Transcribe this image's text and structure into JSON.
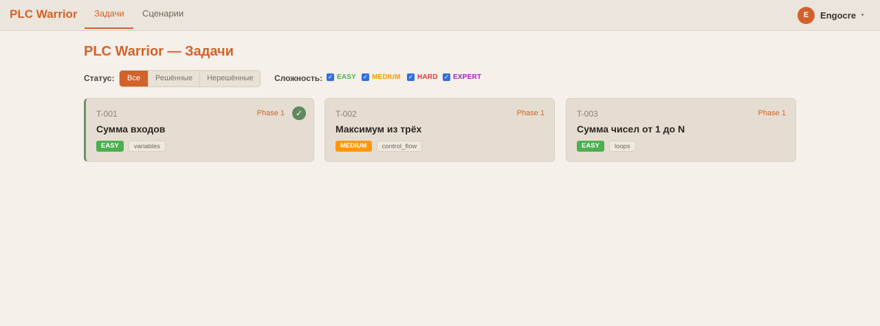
{
  "app": {
    "brand": "PLC Warrior"
  },
  "nav": {
    "tabs": [
      {
        "label": "Задачи",
        "active": true
      },
      {
        "label": "Сценарии",
        "active": false
      }
    ]
  },
  "user": {
    "initial": "E",
    "name": "Engocre"
  },
  "page": {
    "title": "PLC Warrior — Задачи"
  },
  "filters": {
    "status_label": "Статус:",
    "status_options": [
      "Все",
      "Решённые",
      "Нерешённые"
    ],
    "status_selected": "Все",
    "difficulty_label": "Сложность:",
    "difficulties": [
      {
        "label": "EASY",
        "checked": true,
        "color": "#4caf50"
      },
      {
        "label": "MEDIUM",
        "checked": true,
        "color": "#ff9800"
      },
      {
        "label": "HARD",
        "checked": true,
        "color": "#e53935"
      },
      {
        "label": "EXPERT",
        "checked": true,
        "color": "#9c27b0"
      }
    ]
  },
  "tasks": [
    {
      "id": "T-001",
      "phase": "Phase 1",
      "title": "Сумма входов",
      "difficulty": "EASY",
      "difficulty_color": "#4caf50",
      "tag": "variables",
      "solved": true
    },
    {
      "id": "T-002",
      "phase": "Phase 1",
      "title": "Максимум из трёх",
      "difficulty": "MEDIUM",
      "difficulty_color": "#ff9800",
      "tag": "control_flow",
      "solved": false
    },
    {
      "id": "T-003",
      "phase": "Phase 1",
      "title": "Сумма чисел от 1 до N",
      "difficulty": "EASY",
      "difficulty_color": "#4caf50",
      "tag": "loops",
      "solved": false
    }
  ],
  "colors": {
    "accent": "#d2622a",
    "background": "#f5f0ea",
    "solved_green": "#5f8a5e",
    "checkbox_blue": "#2f6fe0"
  }
}
